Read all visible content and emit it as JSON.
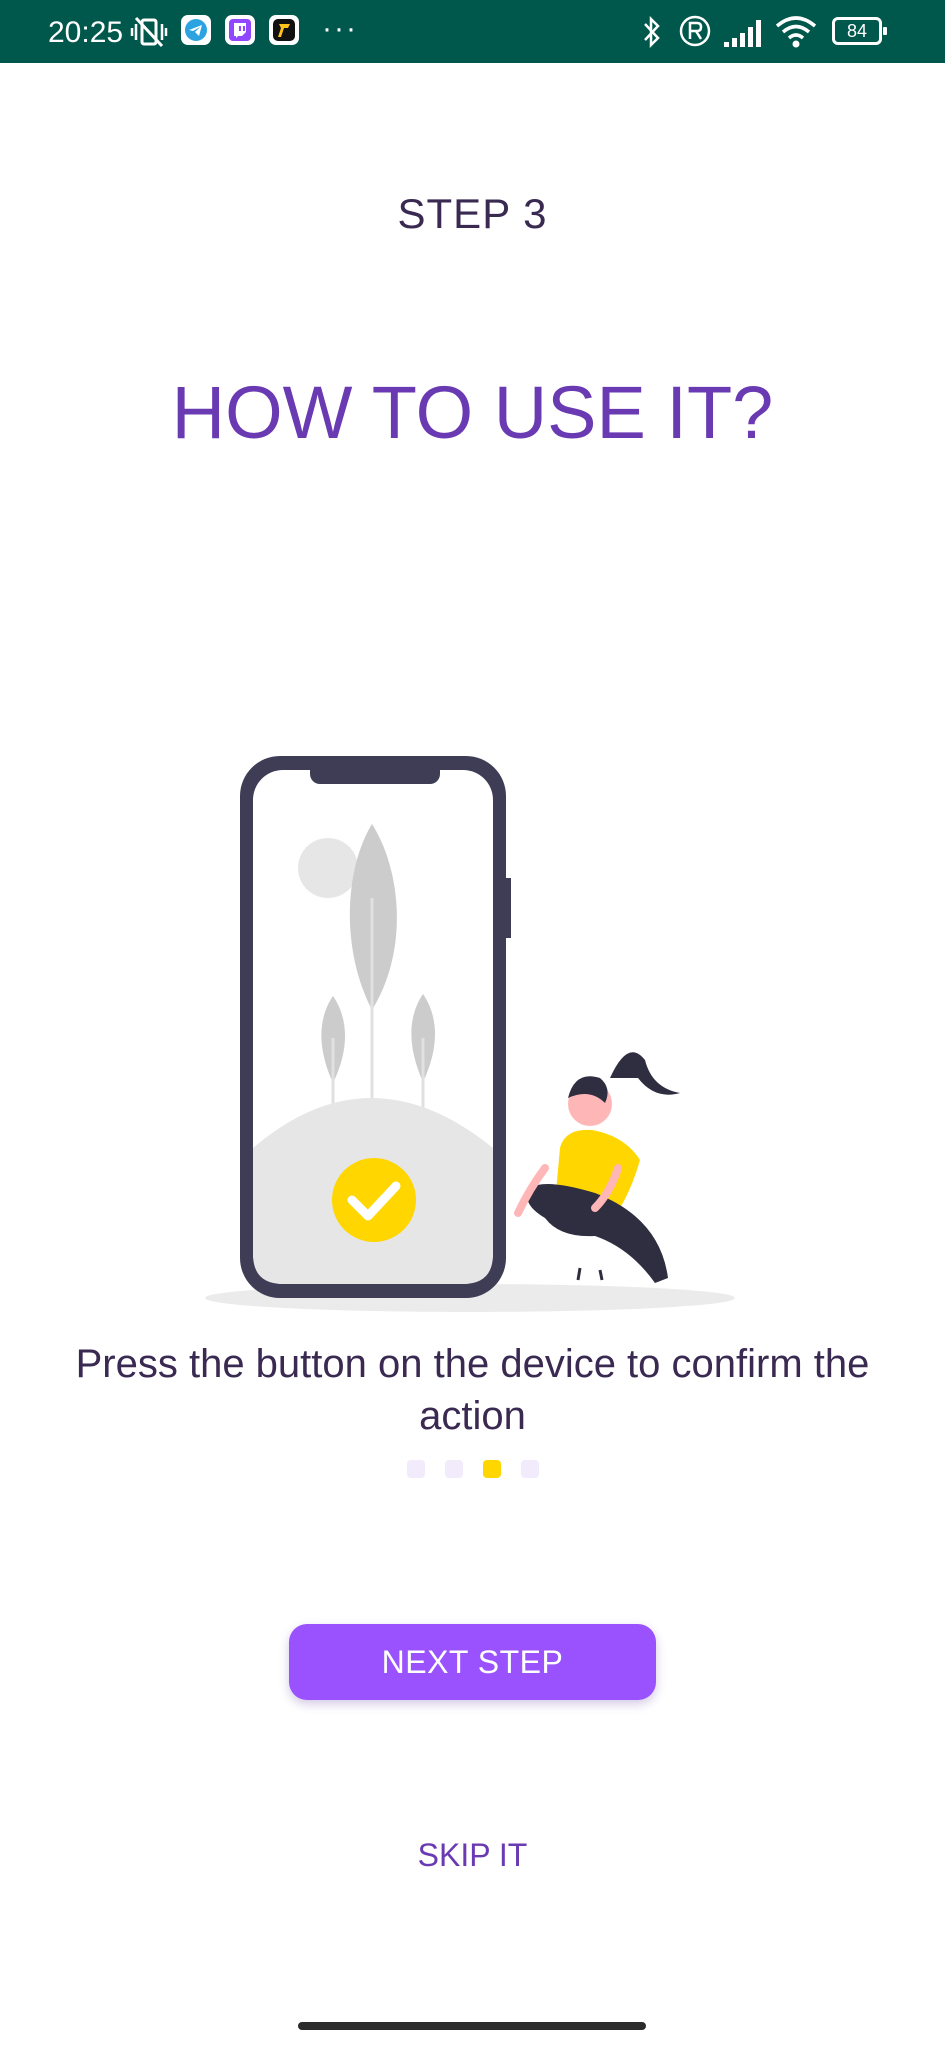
{
  "status_bar": {
    "time": "20:25",
    "battery": "84",
    "more": "···",
    "icons": [
      "vibrate-off-icon",
      "telegram-icon",
      "twitch-icon",
      "app-icon",
      "bluetooth-icon",
      "registered-icon",
      "signal-icon",
      "wifi-icon",
      "battery-icon"
    ]
  },
  "onboarding": {
    "step_label": "STEP 3",
    "title": "HOW TO USE IT?",
    "description": "Press the button on the device to confirm the action",
    "illustration": "phone-confirm-illustration",
    "pagination": {
      "total": 4,
      "active_index": 2
    },
    "next_label": "NEXT STEP",
    "skip_label": "SKIP IT"
  },
  "colors": {
    "status_bar": "#00574b",
    "title": "#6a3ab3",
    "text": "#3a2a52",
    "primary_button": "#9a52ff",
    "accent_yellow": "#ffd600",
    "dot_inactive": "#f1ebfb"
  }
}
